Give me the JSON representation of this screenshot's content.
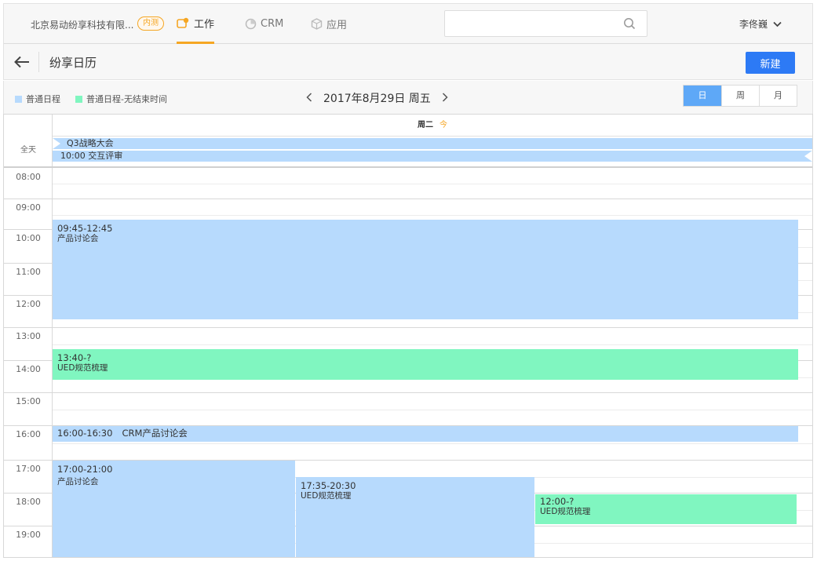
{
  "nav": {
    "company": "北京易动纷享科技有限...",
    "badge": "内测",
    "tabs": [
      {
        "label": "工作",
        "icon": "work-icon",
        "active": true
      },
      {
        "label": "CRM",
        "icon": "crm-pie-icon",
        "active": false
      },
      {
        "label": "应用",
        "icon": "app-box-icon",
        "active": false
      }
    ],
    "search_placeholder": "",
    "user": "李佟巍"
  },
  "header": {
    "title": "纷享日历",
    "new_button": "新建"
  },
  "toolbar": {
    "legend": [
      {
        "label": "普通日程",
        "color": "#b7dafd"
      },
      {
        "label": "普通日程-无结束时间",
        "color": "#80f6c0"
      }
    ],
    "date": "2017年8月29日 周五",
    "views": [
      "日",
      "周",
      "月"
    ],
    "active_view": "日"
  },
  "calendar": {
    "day_header": "周二",
    "today_mark": "今",
    "allday_label": "全天",
    "allday_events": [
      {
        "label": "Q3战略大会"
      },
      {
        "label": "10:00  交互评审"
      }
    ],
    "hours": [
      "08:00",
      "09:00",
      "10:00",
      "11:00",
      "12:00",
      "13:00",
      "14:00",
      "15:00",
      "16:00",
      "17:00",
      "18:00",
      "19:00"
    ],
    "events": [
      {
        "time": "09:45-12:45",
        "title": "产品讨论会",
        "type": "blue"
      },
      {
        "time": "13:40-?",
        "title": "UED规范梳理",
        "type": "green"
      },
      {
        "time": "16:00-16:30",
        "title": "CRM产品讨论会",
        "type": "blue"
      },
      {
        "time": "17:00-21:00",
        "title": "产品讨论会",
        "type": "blue"
      },
      {
        "time": "17:35-20:30",
        "title": "UED规范梳理",
        "type": "blue"
      },
      {
        "time": "12:00-?",
        "title": "UED规范梳理",
        "type": "green"
      }
    ]
  },
  "colors": {
    "accent": "#f5a623",
    "primary": "#2d7af5",
    "event_blue": "#b7dafd",
    "event_green": "#80f6c0"
  }
}
